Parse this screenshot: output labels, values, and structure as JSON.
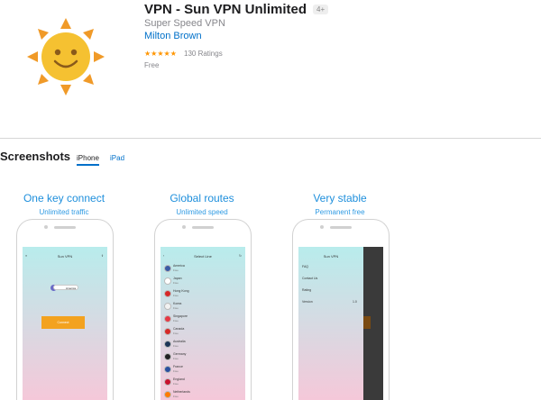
{
  "app": {
    "title": "VPN - Sun VPN Unlimited",
    "age_rating": "4+",
    "subtitle": "Super Speed VPN",
    "developer": "Milton Brown",
    "stars": "★★★★★",
    "rating_value": 4.5,
    "ratings_count": "130 Ratings",
    "price": "Free"
  },
  "screenshots": {
    "title": "Screenshots",
    "tabs": [
      {
        "label": "iPhone",
        "selected": true
      },
      {
        "label": "iPad",
        "selected": false
      }
    ],
    "cards": [
      {
        "caption": "One key connect",
        "sub": "Unlimited traffic",
        "screen": {
          "nav_title": "Sun VPN",
          "location": "America",
          "button": "Connect"
        }
      },
      {
        "caption": "Global routes",
        "sub": "Unlimited speed",
        "screen": {
          "nav_title": "Select Line",
          "lines": [
            {
              "name": "America",
              "sub": "Free"
            },
            {
              "name": "Japan",
              "sub": "Free"
            },
            {
              "name": "Hong Kong",
              "sub": "Free"
            },
            {
              "name": "Korea",
              "sub": "Free"
            },
            {
              "name": "Singapore",
              "sub": "Free"
            },
            {
              "name": "Canada",
              "sub": "Free"
            },
            {
              "name": "Australia",
              "sub": "Free"
            },
            {
              "name": "Germany",
              "sub": "Free"
            },
            {
              "name": "France",
              "sub": "Free"
            },
            {
              "name": "England",
              "sub": "Free"
            },
            {
              "name": "Netherlands",
              "sub": "Free"
            }
          ]
        }
      },
      {
        "caption": "Very stable",
        "sub": "Permanent free",
        "screen": {
          "nav_title": "Sun VPN",
          "menu": [
            "FAQ",
            "Contact Us",
            "Rating",
            "Version"
          ],
          "version": "1.0"
        }
      }
    ]
  },
  "colors": {
    "link": "#0070c9",
    "caption": "#1e8fdc",
    "star": "#ff9500",
    "sun": "#f5b830",
    "sun_rays": "#f09a28",
    "button": "#f3a21f"
  },
  "icons": [
    "sun-icon",
    "star-icon",
    "menu-icon",
    "share-icon",
    "back-icon",
    "refresh-icon",
    "flag-icon"
  ]
}
